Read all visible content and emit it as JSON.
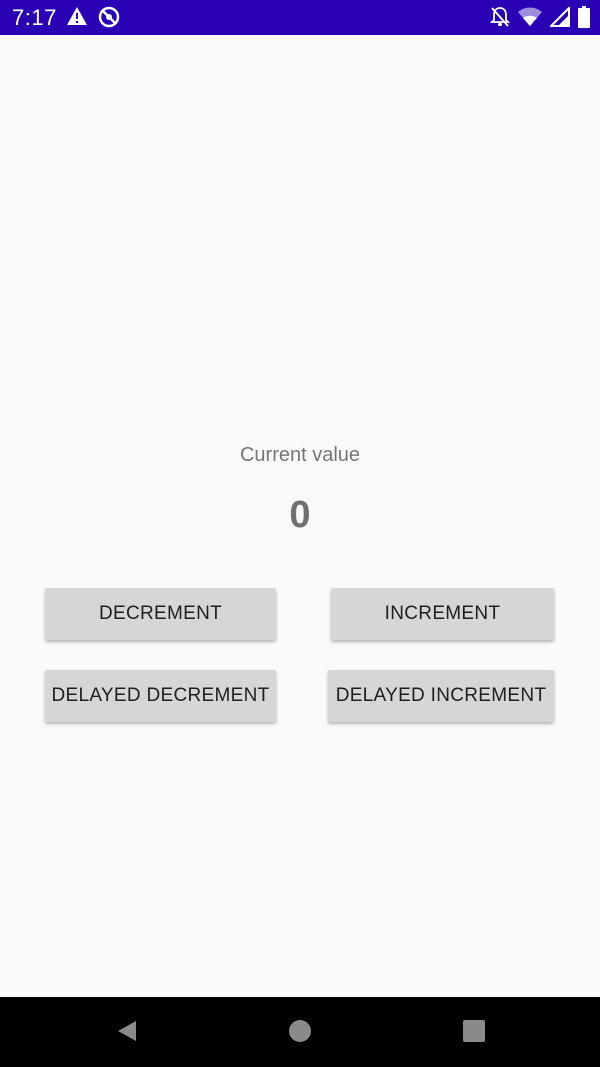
{
  "status_bar": {
    "time": "7:17",
    "background": "#2a00b5",
    "icons_left": [
      "warning-icon",
      "sync-blocked-icon"
    ],
    "icons_right": [
      "notifications-off-icon",
      "wifi-icon",
      "signal-icon",
      "battery-icon"
    ]
  },
  "main": {
    "label": "Current value",
    "value": "0"
  },
  "buttons": {
    "decrement": "DECREMENT",
    "increment": "INCREMENT",
    "delayed_decrement": "DELAYED DECREMENT",
    "delayed_increment": "DELAYED INCREMENT"
  },
  "nav_bar": {
    "icons": [
      "back-icon",
      "home-icon",
      "recents-icon"
    ]
  }
}
